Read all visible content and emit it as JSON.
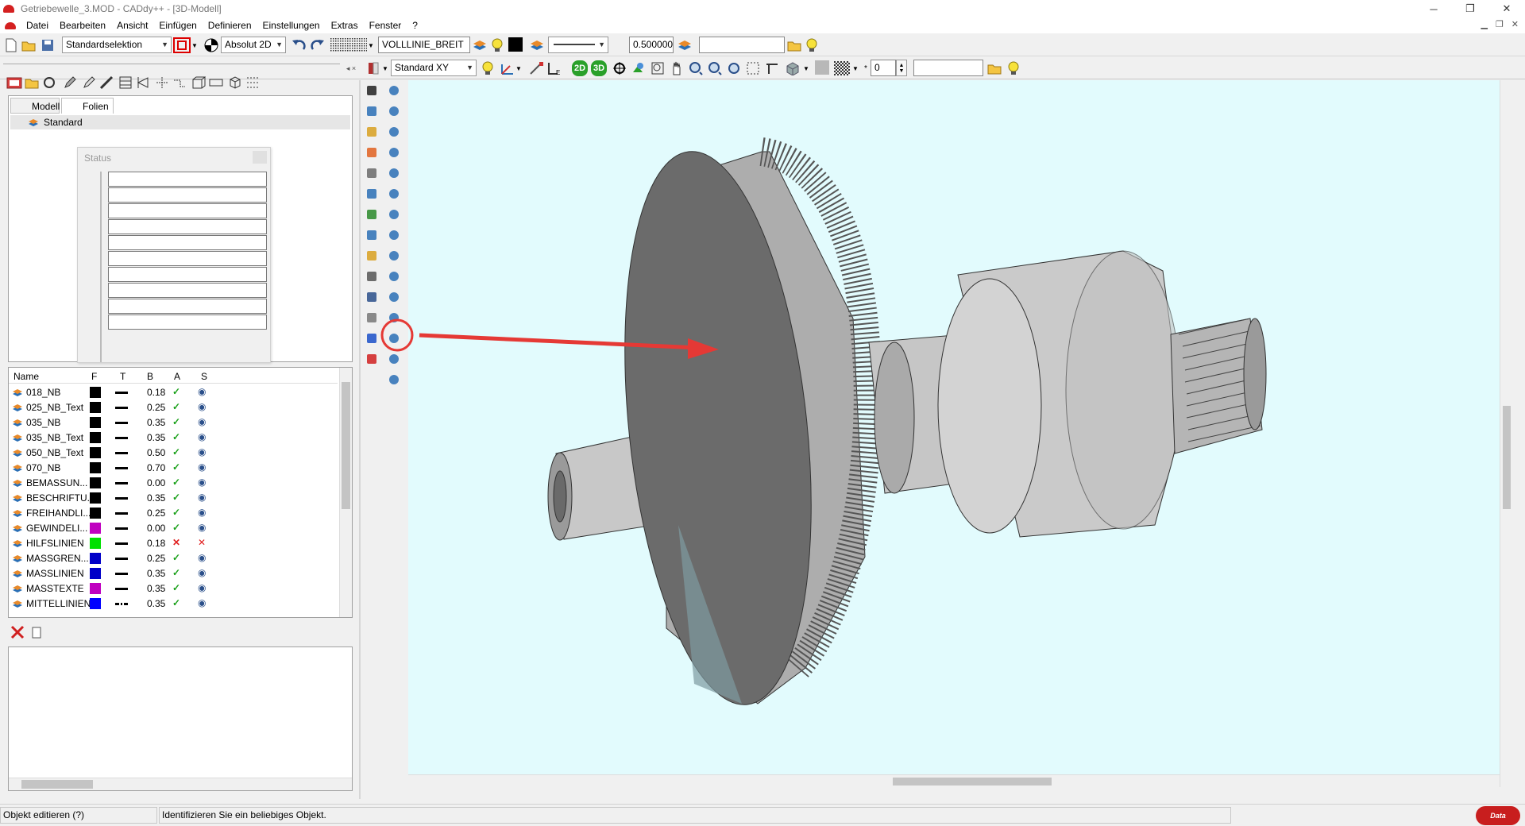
{
  "window": {
    "title": "Getriebewelle_3.MOD  -  CADdy++ - [3D-Modell]"
  },
  "menu": [
    "Datei",
    "Bearbeiten",
    "Ansicht",
    "Einfügen",
    "Definieren",
    "Einstellungen",
    "Extras",
    "Fenster",
    "?"
  ],
  "toolbar1": {
    "selection_mode": "Standardselektion",
    "coord_mode": "Absolut 2D",
    "linetype": "VOLLLINIE_BREIT",
    "linewidth": "0.500000",
    "search_value": ""
  },
  "toolbar2": {
    "view_plane": "Standard XY",
    "mode_2d": "2D",
    "mode_3d": "3D",
    "counter": "0",
    "search_value": ""
  },
  "left_panel": {
    "tabs": [
      "Modell",
      "Folien"
    ],
    "active_tab": "Folien",
    "tree_items": [
      "Standard"
    ],
    "status_window_title": "Status",
    "layer_columns": [
      "Name",
      "F",
      "T",
      "B",
      "A",
      "S"
    ],
    "layers": [
      {
        "name": "018_NB",
        "color": "#000000",
        "width": "0.18",
        "active": true,
        "visible": true,
        "linestyle": "solid"
      },
      {
        "name": "025_NB_Text",
        "color": "#000000",
        "width": "0.25",
        "active": true,
        "visible": true,
        "linestyle": "solid"
      },
      {
        "name": "035_NB",
        "color": "#000000",
        "width": "0.35",
        "active": true,
        "visible": true,
        "linestyle": "solid"
      },
      {
        "name": "035_NB_Text",
        "color": "#000000",
        "width": "0.35",
        "active": true,
        "visible": true,
        "linestyle": "solid"
      },
      {
        "name": "050_NB_Text",
        "color": "#000000",
        "width": "0.50",
        "active": true,
        "visible": true,
        "linestyle": "solid"
      },
      {
        "name": "070_NB",
        "color": "#000000",
        "width": "0.70",
        "active": true,
        "visible": true,
        "linestyle": "solid"
      },
      {
        "name": "BEMASSUN...",
        "color": "#000000",
        "width": "0.00",
        "active": true,
        "visible": true,
        "linestyle": "solid"
      },
      {
        "name": "BESCHRIFTU...",
        "color": "#000000",
        "width": "0.35",
        "active": true,
        "visible": true,
        "linestyle": "solid"
      },
      {
        "name": "FREIHANDLI...",
        "color": "#000000",
        "width": "0.25",
        "active": true,
        "visible": true,
        "linestyle": "solid"
      },
      {
        "name": "GEWINDELI...",
        "color": "#c000c0",
        "width": "0.00",
        "active": true,
        "visible": true,
        "linestyle": "solid"
      },
      {
        "name": "HILFSLINIEN",
        "color": "#00e000",
        "width": "0.18",
        "active": false,
        "visible": false,
        "linestyle": "solid"
      },
      {
        "name": "MASSGREN...",
        "color": "#0000c8",
        "width": "0.25",
        "active": true,
        "visible": true,
        "linestyle": "solid"
      },
      {
        "name": "MASSLINIEN",
        "color": "#0000c8",
        "width": "0.35",
        "active": true,
        "visible": true,
        "linestyle": "solid"
      },
      {
        "name": "MASSTEXTE",
        "color": "#c000c0",
        "width": "0.35",
        "active": true,
        "visible": true,
        "linestyle": "solid"
      },
      {
        "name": "MITTELLINIEN",
        "color": "#0000ff",
        "width": "0.35",
        "active": true,
        "visible": true,
        "linestyle": "dashdot"
      }
    ]
  },
  "statusbar": {
    "command": "Objekt editieren (?)",
    "prompt": "Identifizieren Sie ein beliebiges Objekt."
  },
  "colors": {
    "viewport_bg": "#e2fbfd",
    "accent_red": "#e53935",
    "part_gray": "#c8c8c8"
  }
}
